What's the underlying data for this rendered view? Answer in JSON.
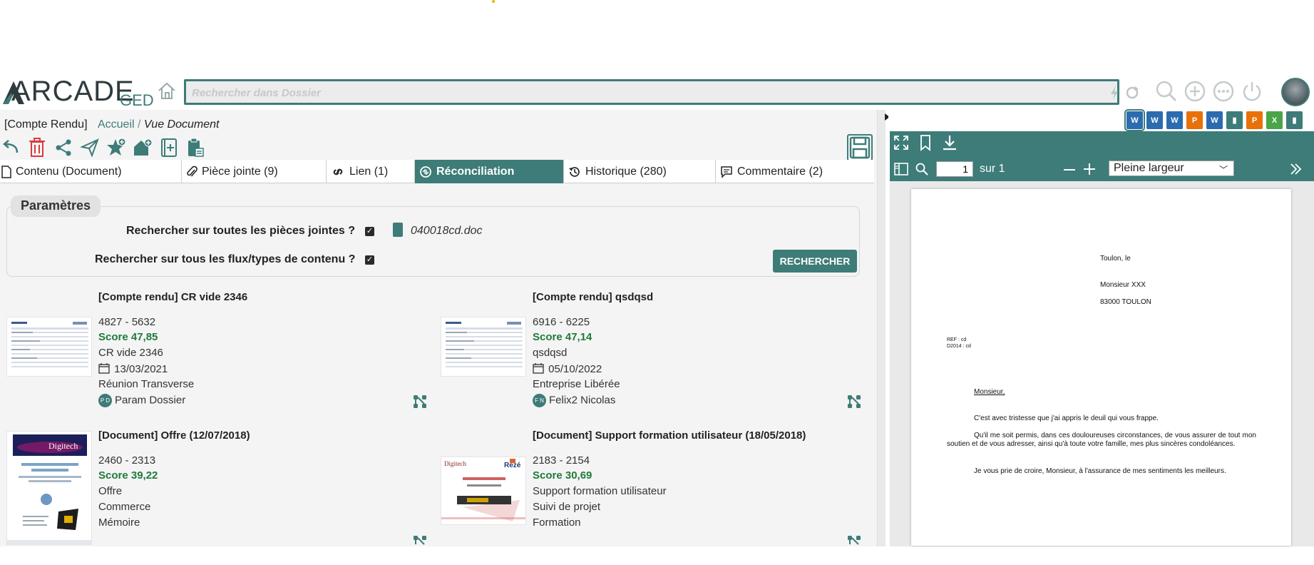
{
  "header": {
    "logo_main": "ARCADE",
    "logo_sub": "GED",
    "search_placeholder": "Rechercher dans Dossier"
  },
  "breadcrumb": {
    "tag": "[Compte Rendu]",
    "home": "Accueil",
    "separator": "/",
    "current": "Vue Document"
  },
  "tabs": [
    {
      "label": "Contenu (Document)"
    },
    {
      "label": "Pièce jointe (9)"
    },
    {
      "label": "Lien (1)"
    },
    {
      "label": "Réconciliation"
    },
    {
      "label": "Historique (280)"
    },
    {
      "label": "Commentaire (2)"
    }
  ],
  "params": {
    "title": "Paramètres",
    "q1": "Rechercher sur toutes les pièces jointes ?",
    "q2": "Rechercher sur tous les flux/types de contenu ?",
    "file": "040018cd.doc",
    "search_btn": "RECHERCHER"
  },
  "cards": [
    {
      "title": "[Compte rendu] CR vide 2346",
      "range": "4827 - 5632",
      "score": "Score 47,85",
      "name": "CR vide 2346",
      "date": "13/03/2021",
      "l5": "Réunion Transverse",
      "initials": "P D",
      "person": "Param Dossier"
    },
    {
      "title": "[Compte rendu] qsdqsd",
      "range": "6916 - 6225",
      "score": "Score 47,14",
      "name": "qsdqsd",
      "date": "05/10/2022",
      "l5": "Entreprise Libérée",
      "initials": "F N",
      "person": "Felix2 Nicolas"
    },
    {
      "title": "[Document] Offre (12/07/2018)",
      "range": "2460 - 2313",
      "score": "Score 39,22",
      "l3": "Offre",
      "l4": "Commerce",
      "l5": "Mémoire"
    },
    {
      "title": "[Document] Support formation utilisateur (18/05/2018)",
      "range": "2183 - 2154",
      "score": "Score 30,69",
      "l3": "Support formation utilisateur",
      "l4": "Suivi de projet",
      "l5": "Formation"
    }
  ],
  "viewer": {
    "page_value": "1",
    "page_total": "sur 1",
    "zoom": "Pleine largeur",
    "file_icons": [
      {
        "label": "W",
        "color": "#2b6cb0"
      },
      {
        "label": "W",
        "color": "#2b6cb0"
      },
      {
        "label": "W",
        "color": "#2b6cb0"
      },
      {
        "label": "P",
        "color": "#e8710a"
      },
      {
        "label": "W",
        "color": "#2b6cb0"
      },
      {
        "label": "▮",
        "color": "#3d7c78"
      },
      {
        "label": "P",
        "color": "#e8710a"
      },
      {
        "label": "X",
        "color": "#4aa548"
      },
      {
        "label": "▮",
        "color": "#3d7c78"
      }
    ],
    "doc": {
      "place": "Toulon, le",
      "addr1": "Monsieur XXX",
      "addr2": "83000 TOULON",
      "ref1": "REF : cd",
      "ref2": "D2014 : cd",
      "salutation": "Monsieur,",
      "p1": "C'est avec tristesse que j'ai appris le deuil qui vous frappe.",
      "p2": "Qu'il me soit permis, dans ces douloureuses circonstances, de vous assurer de tout mon soutien et de vous adresser, ainsi qu'à toute votre famille, mes plus sincères condoléances.",
      "p3": "Je vous prie de croire, Monsieur, à l'assurance de mes sentiments les meilleurs."
    }
  },
  "colors": {
    "accent": "#3d7c78",
    "score": "#1f7a3a",
    "delete": "#d93a3a"
  }
}
